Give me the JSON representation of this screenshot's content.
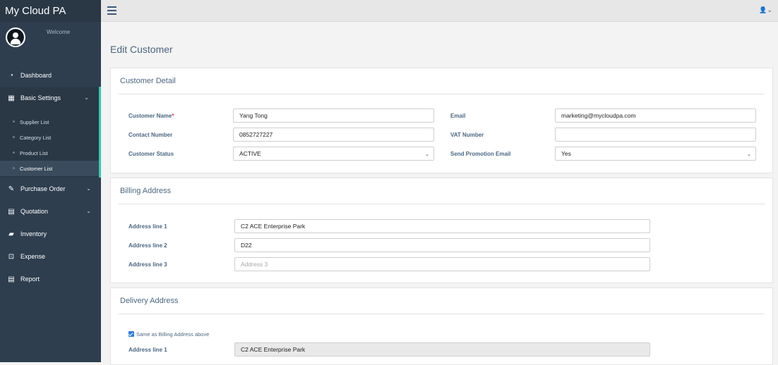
{
  "sidebar": {
    "brand": "My Cloud PA",
    "welcome": "Welcome",
    "items": [
      {
        "label": "Dashboard",
        "icon": "dashboard-icon"
      },
      {
        "label": "Basic Settings",
        "icon": "table-icon"
      },
      {
        "label": "Purchase Order",
        "icon": "edit-icon"
      },
      {
        "label": "Quotation",
        "icon": "file-icon"
      },
      {
        "label": "Inventory",
        "icon": "book-icon"
      },
      {
        "label": "Expense",
        "icon": "money-icon"
      },
      {
        "label": "Report",
        "icon": "report-icon"
      }
    ],
    "submenu": [
      "Supplier List",
      "Category List",
      "Product List",
      "Customer List"
    ]
  },
  "page": {
    "title": "Edit Customer"
  },
  "customer_detail": {
    "title": "Customer Detail",
    "name_label": "Customer Name",
    "required_mark": "*",
    "name_value": "Yang Tong",
    "contact_label": "Contact Number",
    "contact_value": "0852727227",
    "status_label": "Customer Status",
    "status_value": "ACTIVE",
    "email_label": "Email",
    "email_value": "marketing@mycloudpa.com",
    "vat_label": "VAT Number",
    "vat_value": "",
    "promo_label": "Send Promotion Email",
    "promo_value": "Yes"
  },
  "billing": {
    "title": "Billing Address",
    "line1_label": "Address line 1",
    "line1_value": "C2 ACE Enterprise Park",
    "line2_label": "Address line 2",
    "line2_value": "D22",
    "line3_label": "Address line 3",
    "line3_placeholder": "Address 3"
  },
  "delivery": {
    "title": "Delivery Address",
    "same_label": "Same as Billing Address above",
    "line1_label": "Address line 1",
    "line1_value": "C2 ACE Enterprise Park"
  },
  "colors": {
    "sidebar": "#2e3e4f",
    "accent": "#38c9b0",
    "heading": "#4b6682"
  }
}
